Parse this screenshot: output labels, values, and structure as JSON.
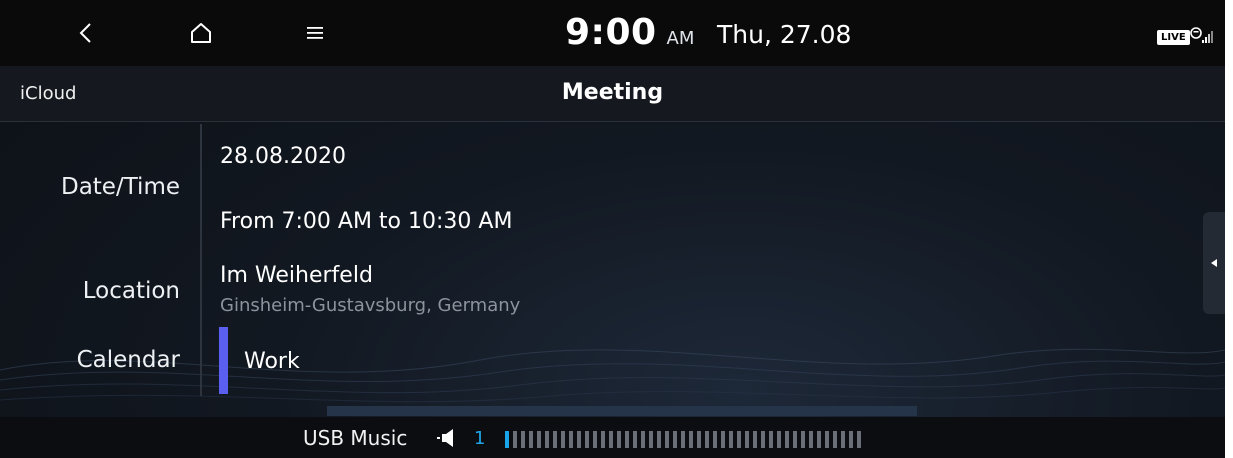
{
  "status_bar": {
    "back_icon": "chevron-left-icon",
    "home_icon": "home-icon",
    "menu_icon": "hamburger-menu-icon",
    "time": "9:00",
    "ampm": "AM",
    "date": "Thu, 27.08",
    "live_badge": "LIVE",
    "signal_icon": "phone-signal-icon"
  },
  "title_bar": {
    "source": "iCloud",
    "title": "Meeting"
  },
  "details": {
    "labels": {
      "datetime": "Date/Time",
      "location": "Location",
      "calendar": "Calendar"
    },
    "date": "28.08.2020",
    "time_range": "From 7:00 AM to 10:30 AM",
    "location_name": "Im Weiherfeld",
    "location_detail": "Ginsheim-Gustavsburg, Germany",
    "calendar_name": "Work",
    "calendar_color": "#5a5ff0"
  },
  "side_panel": {
    "icon": "caret-left-icon"
  },
  "bottom_bar": {
    "media_source": "USB Music",
    "speaker_icon": "speaker-icon",
    "volume": "1",
    "volume_level": 1,
    "volume_max": 45,
    "accent_color": "#19a4ea"
  }
}
